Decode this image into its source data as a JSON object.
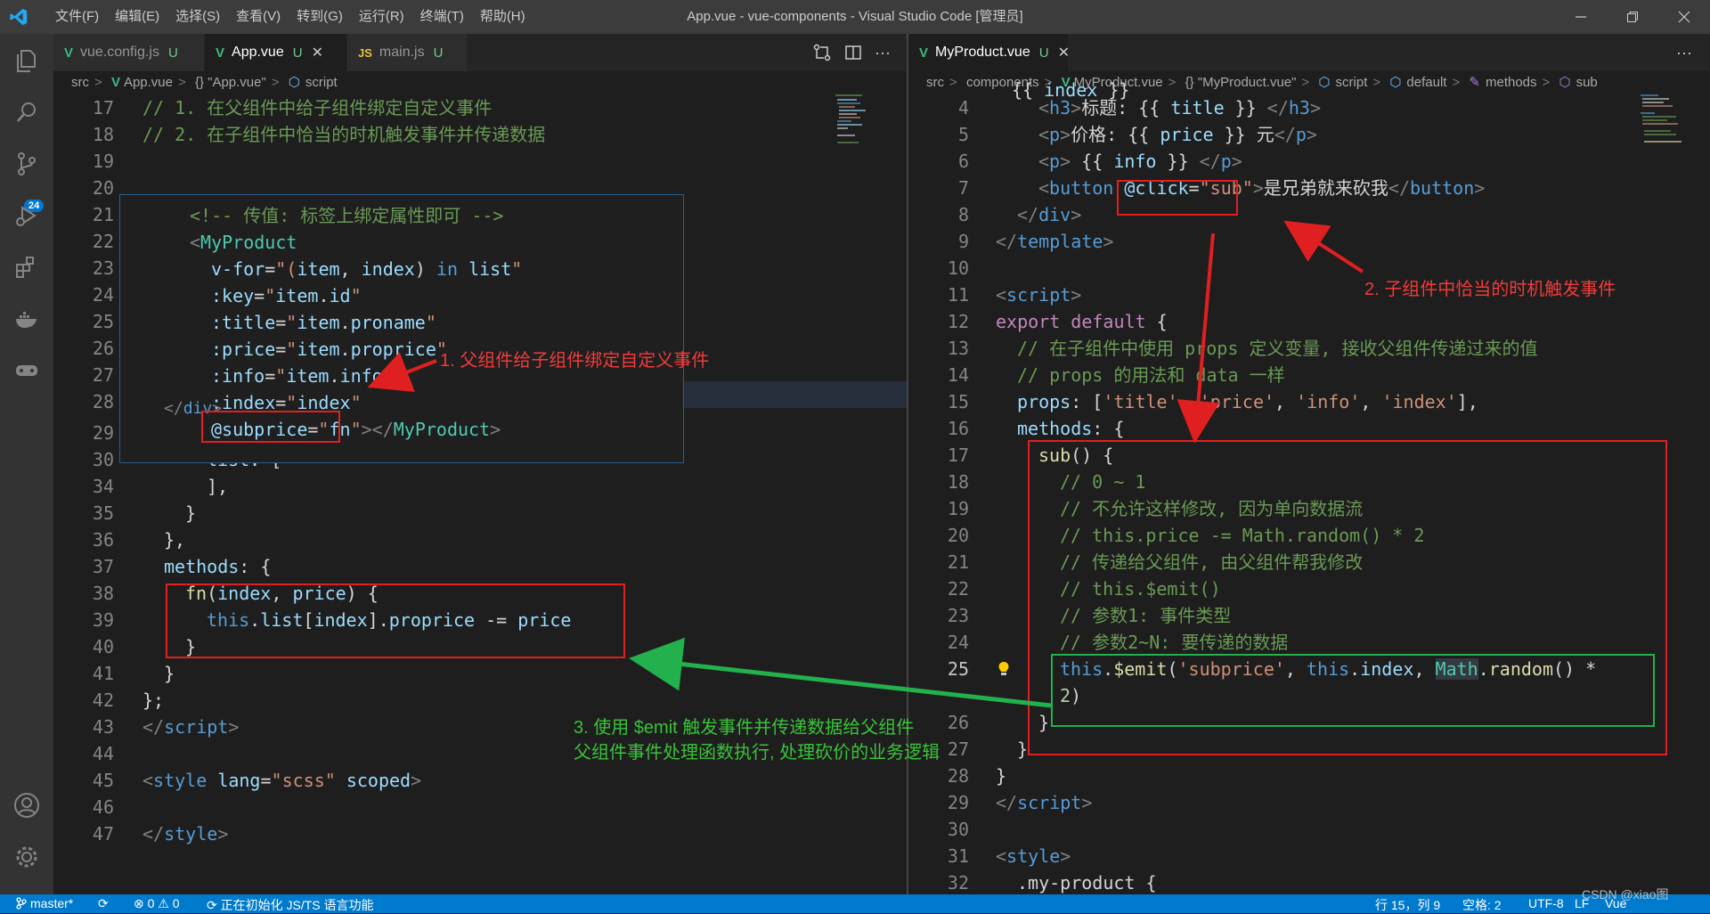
{
  "titlebar": {
    "menu": [
      "文件(F)",
      "编辑(E)",
      "选择(S)",
      "查看(V)",
      "转到(G)",
      "运行(R)",
      "终端(T)",
      "帮助(H)"
    ],
    "title": "App.vue - vue-components - Visual Studio Code [管理员]"
  },
  "left": {
    "tabs": [
      {
        "name": "vue.config.js",
        "status": "U",
        "icon": "vue"
      },
      {
        "name": "App.vue",
        "status": "U",
        "icon": "vue",
        "active": true
      },
      {
        "name": "main.js",
        "status": "U",
        "icon": "js"
      }
    ],
    "breadcrumb": [
      "src",
      ">",
      "App.vue",
      ">",
      "{} \"App.vue\"",
      ">",
      "script"
    ]
  },
  "right": {
    "tabs": [
      {
        "name": "MyProduct.vue",
        "status": "U",
        "icon": "vue",
        "active": true
      }
    ],
    "breadcrumb": [
      "src",
      ">",
      "components",
      ">",
      "MyProduct.vue",
      ">",
      "{} \"MyProduct.vue\"",
      ">",
      "script",
      ">",
      "default",
      ">",
      "methods",
      ">",
      "sub"
    ]
  },
  "annotations": {
    "a1": "1. 父组件给子组件绑定自定义事件",
    "a2": "2. 子组件中恰当的时机触发事件",
    "a3_1": "3. 使用 $emit 触发事件并传递数据给父组件",
    "a3_2": "父组件事件处理函数执行, 处理砍价的业务逻辑"
  },
  "statusbar": {
    "branch": "master*",
    "errors": "0",
    "warnings": "0",
    "task": "正在初始化 JS/TS 语言功能",
    "position": "行 15，列 9",
    "spaces": "空格: 2",
    "encoding": "UTF-8",
    "eol": "LF",
    "lang": "Vue",
    "watermark": "CSDN @xiao图"
  },
  "colors": {
    "statusbar": "#007acc",
    "red": "#e02020",
    "green": "#22b14c"
  }
}
